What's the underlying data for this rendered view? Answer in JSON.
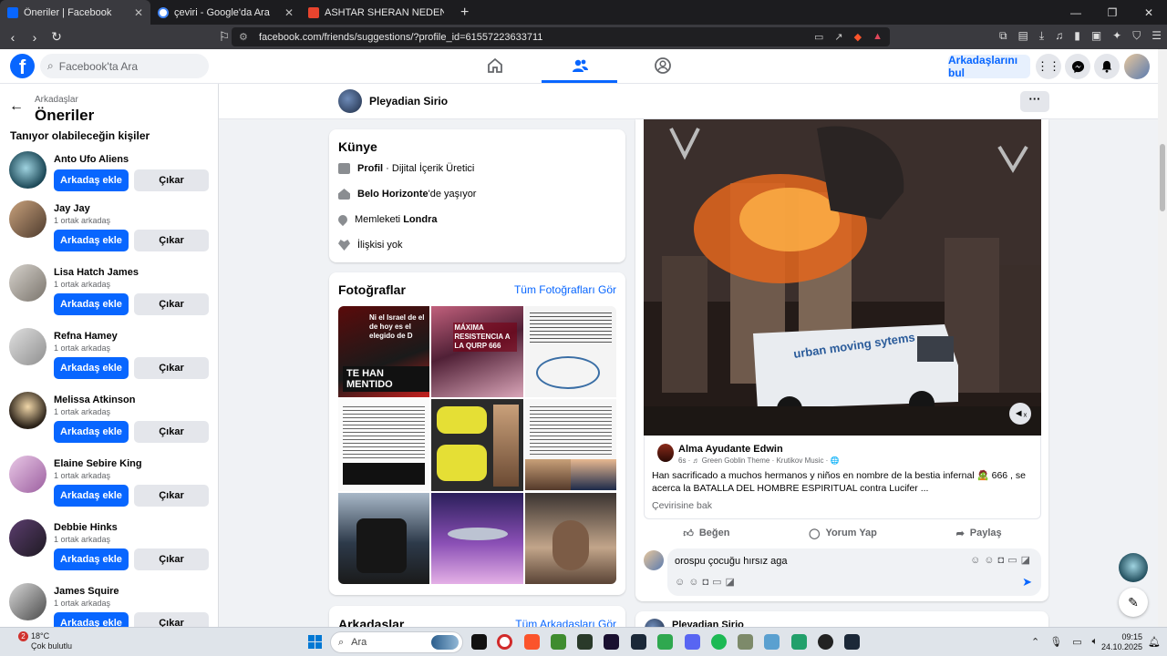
{
  "browser": {
    "tabs": [
      {
        "title": "Öneriler | Facebook",
        "active": true,
        "favicon_color": "#0866ff"
      },
      {
        "title": "çeviri - Google'da Ara",
        "active": false,
        "favicon_color": "#4285f4"
      },
      {
        "title": "ASHTAR SHERAN NEDEN HENÜZ SM",
        "active": false,
        "favicon_color": "#e8442e"
      }
    ],
    "new_tab": "+",
    "url": "facebook.com/friends/suggestions/?profile_id=61557223633711"
  },
  "header": {
    "logo": "f",
    "search_placeholder": "Facebook'ta Ara",
    "find_friends": "Arkadaşlarını bul",
    "brand_color": "#0866ff"
  },
  "sidebar": {
    "breadcrumb": "Arkadaşlar",
    "title": "Öneriler",
    "subtitle": "Tanıyor olabileceğin kişiler",
    "add_label": "Arkadaş ekle",
    "remove_label": "Çıkar",
    "people": [
      {
        "name": "Anto Ufo Aliens",
        "mutual": ""
      },
      {
        "name": "Jay Jay",
        "mutual": "1 ortak arkadaş"
      },
      {
        "name": "Lisa Hatch James",
        "mutual": "1 ortak arkadaş"
      },
      {
        "name": "Refna Hamey",
        "mutual": "1 ortak arkadaş"
      },
      {
        "name": "Melissa Atkinson",
        "mutual": "1 ortak arkadaş"
      },
      {
        "name": "Elaine Sebire King",
        "mutual": "1 ortak arkadaş"
      },
      {
        "name": "Debbie Hinks",
        "mutual": "1 ortak arkadaş"
      },
      {
        "name": "James Squire",
        "mutual": "1 ortak arkadaş"
      }
    ]
  },
  "profile": {
    "name": "Pleyadian Sirio",
    "more": "···"
  },
  "intro": {
    "title": "Künye",
    "profile_label": "Profil",
    "profile_value": " · Dijital İçerik Üretici",
    "lives_city": "Belo Horizonte",
    "lives_suffix": "'de yaşıyor",
    "from_prefix": "Memleketi ",
    "from_city": "Londra",
    "relationship": "İlişkisi yok"
  },
  "photos": {
    "title": "Fotoğraflar",
    "see_all": "Tüm Fotoğrafları Gör",
    "captions": [
      "Ni el Israel de el de hoy es el elegido de D",
      "TE HAN MENTIDO",
      "MÁXIMA RESISTENCIA A LA QURP 666"
    ]
  },
  "friends_section": {
    "title": "Arkadaşlar",
    "see_all": "Tüm Arkadaşları Gör"
  },
  "post": {
    "van_text": "urban moving sytems",
    "author": "Alma Ayudante Edwin",
    "meta": "6s · ♬ Green Goblin Theme · Krutikov Music · 🌐",
    "text": "Han sacrificado a muchos hermanos y niños  en   nombre de la  bestia infernal 🧟 666 , se acerca la BATALLA DEL HOMBRE  ESPIRITUAL contra Lucifer ...",
    "translate": "Çevirisine bak",
    "like": "Beğen",
    "comment": "Yorum Yap",
    "share": "Paylaş",
    "comment_draft": "orospu çocuğu hırsız aga"
  },
  "next_post": {
    "author": "Pleyadian Sirio"
  },
  "taskbar": {
    "temp": "18°C",
    "weather": "Çok bulutlu",
    "badge": "2",
    "search": "Ara",
    "time": "09:15",
    "date": "24.10.2025"
  }
}
